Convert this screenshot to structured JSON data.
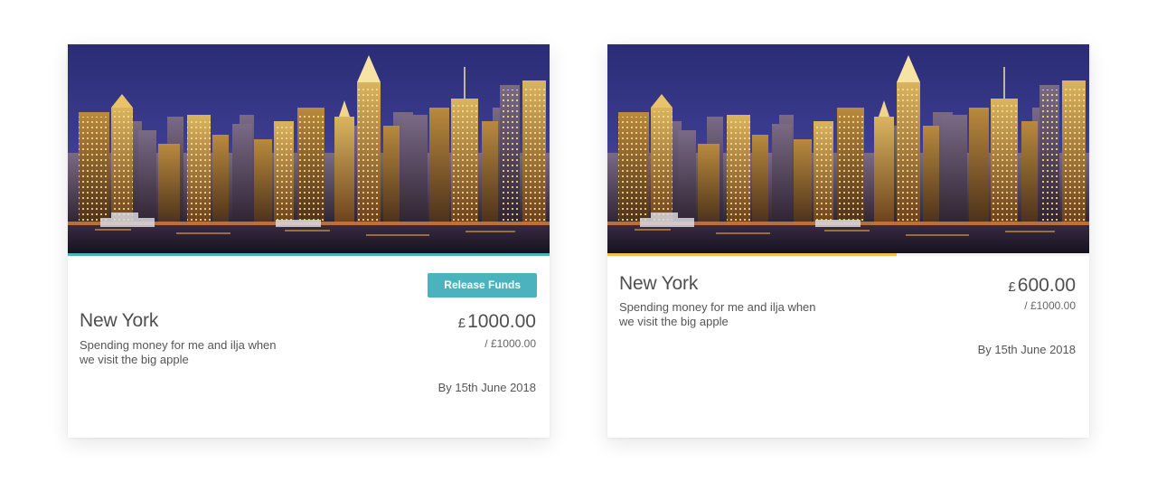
{
  "colors": {
    "accent_teal": "#4bb3be",
    "accent_yellow": "#f1c044",
    "text_dark": "#4f4f4f"
  },
  "cards": [
    {
      "image_alt": "New York skyline at night",
      "title": "New York",
      "description": "Spending money for me and ilja when we visit the big apple",
      "currency_symbol": "£",
      "amount": "1000.00",
      "target": "/ £1000.00",
      "deadline": "By 15th June 2018",
      "progress": 1.0,
      "progress_color": "#4bb3be",
      "action_label": "Release Funds"
    },
    {
      "image_alt": "New York skyline at night",
      "title": "New York",
      "description": "Spending money for me and ilja when we visit the big apple",
      "currency_symbol": "£",
      "amount": "600.00",
      "target": "/ £1000.00",
      "deadline": "By 15th June 2018",
      "progress": 0.6,
      "progress_color": "#f1c044"
    }
  ]
}
